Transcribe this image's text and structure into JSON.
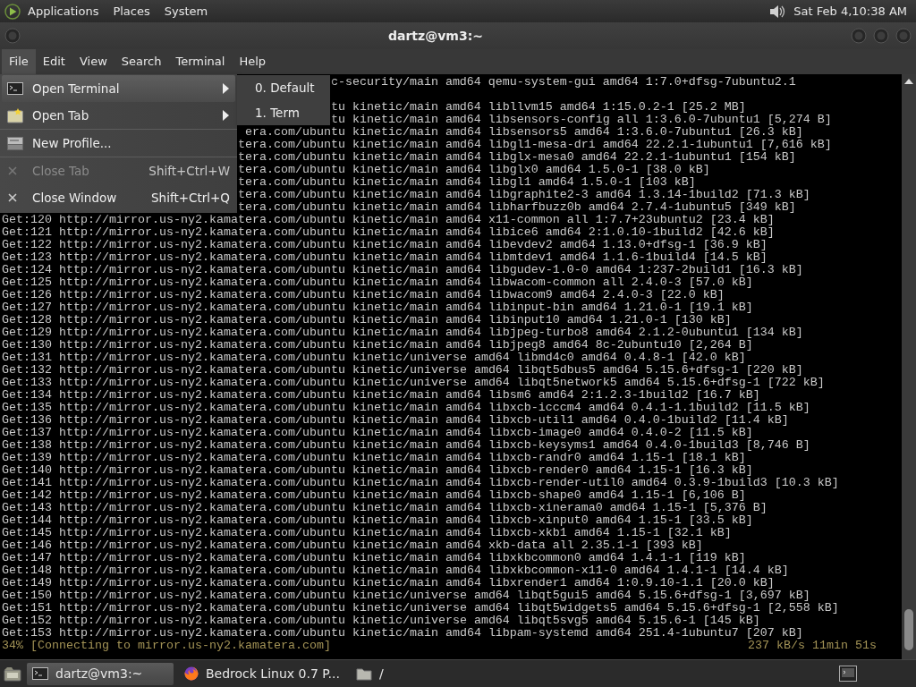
{
  "top_panel": {
    "menus": [
      "Applications",
      "Places",
      "System"
    ],
    "clock": "Sat Feb 4,10:38 AM"
  },
  "window": {
    "title": "dartz@vm3:~"
  },
  "menubar": [
    {
      "label": "File",
      "selected": true
    },
    {
      "label": "Edit",
      "selected": false
    },
    {
      "label": "View",
      "selected": false
    },
    {
      "label": "Search",
      "selected": false
    },
    {
      "label": "Terminal",
      "selected": false
    },
    {
      "label": "Help",
      "selected": false
    }
  ],
  "file_menu": {
    "items": [
      {
        "kind": "submenu",
        "label": "Open Terminal",
        "selected": true,
        "disabled": false
      },
      {
        "kind": "submenu",
        "label": "Open Tab",
        "selected": false,
        "disabled": false
      },
      {
        "kind": "separator"
      },
      {
        "kind": "item",
        "label": "New Profile...",
        "selected": false,
        "disabled": false
      },
      {
        "kind": "separator"
      },
      {
        "kind": "item",
        "label": "Close Tab",
        "shortcut": "Shift+Ctrl+W",
        "selected": false,
        "disabled": true
      },
      {
        "kind": "item",
        "label": "Close Window",
        "shortcut": "Shift+Ctrl+Q",
        "selected": false,
        "disabled": false
      }
    ],
    "submenu": [
      "0. Default",
      "1. Term"
    ]
  },
  "terminal": {
    "first_line": "c-security/main amd64 qemu-system-gui amd64 1:7.0+dfsg-7ubuntu2.1",
    "lines": [
      "tu kinetic/main amd64 libllvm15 amd64 1:15.0.2-1 [25.2 MB]",
      "tu kinetic/main amd64 libsensors-config all 1:3.6.0-7ubuntu1 [5,274 B]",
      "era.com/ubuntu kinetic/main amd64 libsensors5 amd64 1:3.6.0-7ubuntu1 [26.3 kB]",
      "tera.com/ubuntu kinetic/main amd64 libgl1-mesa-dri amd64 22.2.1-1ubuntu1 [7,616 kB]",
      "tera.com/ubuntu kinetic/main amd64 libglx-mesa0 amd64 22.2.1-1ubuntu1 [154 kB]",
      "tera.com/ubuntu kinetic/main amd64 libglx0 amd64 1.5.0-1 [38.0 kB]",
      "tera.com/ubuntu kinetic/main amd64 libgl1 amd64 1.5.0-1 [103 kB]",
      "tera.com/ubuntu kinetic/main amd64 libgraphite2-3 amd64 1.3.14-1build2 [71.3 kB]",
      "tera.com/ubuntu kinetic/main amd64 libharfbuzz0b amd64 2.7.4-1ubuntu5 [349 kB]",
      "Get:120 http://mirror.us-ny2.kamatera.com/ubuntu kinetic/main amd64 x11-common all 1:7.7+23ubuntu2 [23.4 kB]",
      "Get:121 http://mirror.us-ny2.kamatera.com/ubuntu kinetic/main amd64 libice6 amd64 2:1.0.10-1build2 [42.6 kB]",
      "Get:122 http://mirror.us-ny2.kamatera.com/ubuntu kinetic/main amd64 libevdev2 amd64 1.13.0+dfsg-1 [36.9 kB]",
      "Get:123 http://mirror.us-ny2.kamatera.com/ubuntu kinetic/main amd64 libmtdev1 amd64 1.1.6-1build4 [14.5 kB]",
      "Get:124 http://mirror.us-ny2.kamatera.com/ubuntu kinetic/main amd64 libgudev-1.0-0 amd64 1:237-2build1 [16.3 kB]",
      "Get:125 http://mirror.us-ny2.kamatera.com/ubuntu kinetic/main amd64 libwacom-common all 2.4.0-3 [57.0 kB]",
      "Get:126 http://mirror.us-ny2.kamatera.com/ubuntu kinetic/main amd64 libwacom9 amd64 2.4.0-3 [22.0 kB]",
      "Get:127 http://mirror.us-ny2.kamatera.com/ubuntu kinetic/main amd64 libinput-bin amd64 1.21.0-1 [19.1 kB]",
      "Get:128 http://mirror.us-ny2.kamatera.com/ubuntu kinetic/main amd64 libinput10 amd64 1.21.0-1 [130 kB]",
      "Get:129 http://mirror.us-ny2.kamatera.com/ubuntu kinetic/main amd64 libjpeg-turbo8 amd64 2.1.2-0ubuntu1 [134 kB]",
      "Get:130 http://mirror.us-ny2.kamatera.com/ubuntu kinetic/main amd64 libjpeg8 amd64 8c-2ubuntu10 [2,264 B]",
      "Get:131 http://mirror.us-ny2.kamatera.com/ubuntu kinetic/universe amd64 libmd4c0 amd64 0.4.8-1 [42.0 kB]",
      "Get:132 http://mirror.us-ny2.kamatera.com/ubuntu kinetic/universe amd64 libqt5dbus5 amd64 5.15.6+dfsg-1 [220 kB]",
      "Get:133 http://mirror.us-ny2.kamatera.com/ubuntu kinetic/universe amd64 libqt5network5 amd64 5.15.6+dfsg-1 [722 kB]",
      "Get:134 http://mirror.us-ny2.kamatera.com/ubuntu kinetic/main amd64 libsm6 amd64 2:1.2.3-1build2 [16.7 kB]",
      "Get:135 http://mirror.us-ny2.kamatera.com/ubuntu kinetic/main amd64 libxcb-icccm4 amd64 0.4.1-1.1build2 [11.5 kB]",
      "Get:136 http://mirror.us-ny2.kamatera.com/ubuntu kinetic/main amd64 libxcb-util1 amd64 0.4.0-1build2 [11.4 kB]",
      "Get:137 http://mirror.us-ny2.kamatera.com/ubuntu kinetic/main amd64 libxcb-image0 amd64 0.4.0-2 [11.5 kB]",
      "Get:138 http://mirror.us-ny2.kamatera.com/ubuntu kinetic/main amd64 libxcb-keysyms1 amd64 0.4.0-1build3 [8,746 B]",
      "Get:139 http://mirror.us-ny2.kamatera.com/ubuntu kinetic/main amd64 libxcb-randr0 amd64 1.15-1 [18.1 kB]",
      "Get:140 http://mirror.us-ny2.kamatera.com/ubuntu kinetic/main amd64 libxcb-render0 amd64 1.15-1 [16.3 kB]",
      "Get:141 http://mirror.us-ny2.kamatera.com/ubuntu kinetic/main amd64 libxcb-render-util0 amd64 0.3.9-1build3 [10.3 kB]",
      "Get:142 http://mirror.us-ny2.kamatera.com/ubuntu kinetic/main amd64 libxcb-shape0 amd64 1.15-1 [6,106 B]",
      "Get:143 http://mirror.us-ny2.kamatera.com/ubuntu kinetic/main amd64 libxcb-xinerama0 amd64 1.15-1 [5,376 B]",
      "Get:144 http://mirror.us-ny2.kamatera.com/ubuntu kinetic/main amd64 libxcb-xinput0 amd64 1.15-1 [33.5 kB]",
      "Get:145 http://mirror.us-ny2.kamatera.com/ubuntu kinetic/main amd64 libxcb-xkb1 amd64 1.15-1 [32.1 kB]",
      "Get:146 http://mirror.us-ny2.kamatera.com/ubuntu kinetic/main amd64 xkb-data all 2.35.1-1 [393 kB]",
      "Get:147 http://mirror.us-ny2.kamatera.com/ubuntu kinetic/main amd64 libxkbcommon0 amd64 1.4.1-1 [119 kB]",
      "Get:148 http://mirror.us-ny2.kamatera.com/ubuntu kinetic/main amd64 libxkbcommon-x11-0 amd64 1.4.1-1 [14.4 kB]",
      "Get:149 http://mirror.us-ny2.kamatera.com/ubuntu kinetic/main amd64 libxrender1 amd64 1:0.9.10-1.1 [20.0 kB]",
      "Get:150 http://mirror.us-ny2.kamatera.com/ubuntu kinetic/universe amd64 libqt5gui5 amd64 5.15.6+dfsg-1 [3,697 kB]",
      "Get:151 http://mirror.us-ny2.kamatera.com/ubuntu kinetic/universe amd64 libqt5widgets5 amd64 5.15.6+dfsg-1 [2,558 kB]",
      "Get:152 http://mirror.us-ny2.kamatera.com/ubuntu kinetic/universe amd64 libqt5svg5 amd64 5.15.6-1 [145 kB]",
      "Get:153 http://mirror.us-ny2.kamatera.com/ubuntu kinetic/main amd64 libpam-systemd amd64 251.4-1ubuntu7 [207 kB]"
    ],
    "status": {
      "progress": "34% [Connecting to mirror.us-ny2.kamatera.com]",
      "speed": "237 kB/s 11min 51s"
    }
  },
  "taskbar": [
    {
      "label": "dartz@vm3:~",
      "selected": true
    },
    {
      "label": "Bedrock Linux 0.7 P...",
      "selected": false
    },
    {
      "label": "/",
      "selected": false
    }
  ]
}
